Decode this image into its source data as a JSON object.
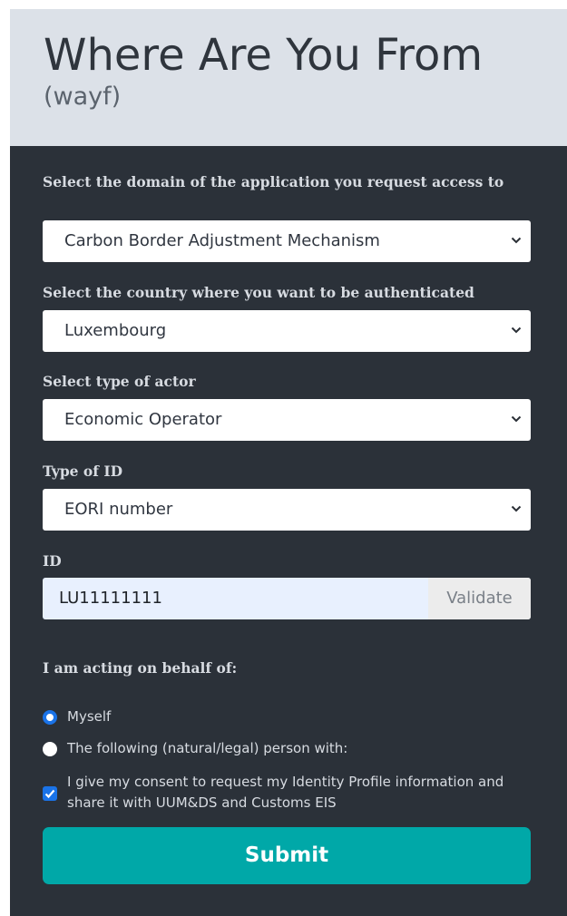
{
  "header": {
    "title": "Where Are You From",
    "subtitle": "(wayf)"
  },
  "form": {
    "domain_label": "Select the domain of the application you request access to",
    "domain_value": "Carbon Border Adjustment Mechanism",
    "country_label": "Select the country where you want to be authenticated",
    "country_value": "Luxembourg",
    "actor_label": "Select type of actor",
    "actor_value": "Economic Operator",
    "idtype_label": "Type of ID",
    "idtype_value": "EORI number",
    "id_label": "ID",
    "id_value": "LU11111111",
    "validate_label": "Validate",
    "behalf_label": "I am acting on behalf of:",
    "option_myself": "Myself",
    "option_other": "The following (natural/legal) person with:",
    "consent_text": "I give my consent to request my Identity Profile information and share it with UUM&DS and Customs EIS",
    "submit_label": "Submit"
  },
  "state": {
    "selected_option": "Myself",
    "consent_checked": true
  },
  "colors": {
    "header_bg": "#dce1e8",
    "body_bg": "#2b3139",
    "submit_bg": "#00a8a8",
    "accent": "#1a73e8"
  },
  "icons": {
    "select_arrow": "chevron-down-icon",
    "checkbox": "checkmark-icon"
  }
}
